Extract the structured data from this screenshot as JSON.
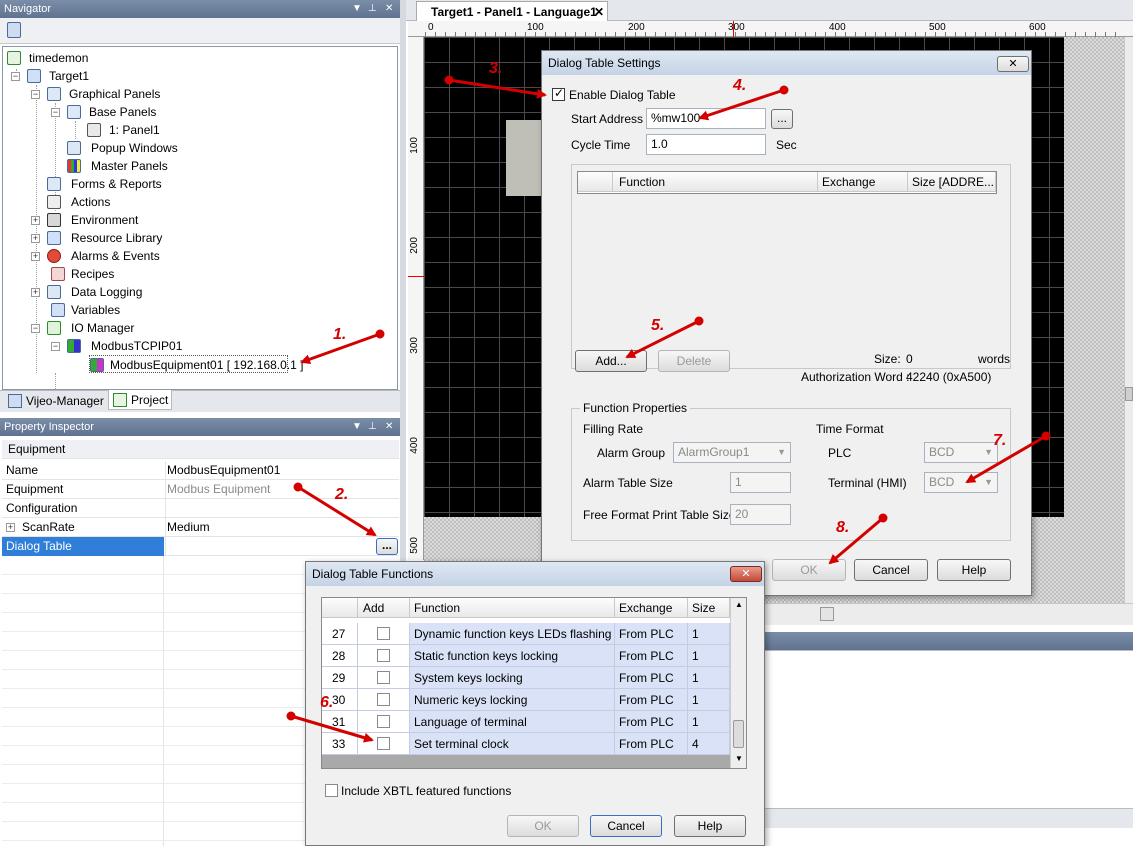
{
  "navigator": {
    "title": "Navigator",
    "tree": [
      {
        "label": "timedemon",
        "icon": "project-icon"
      },
      {
        "label": "Target1",
        "icon": "target-icon"
      },
      {
        "label": "Graphical Panels",
        "icon": "panels-icon"
      },
      {
        "label": "Base Panels",
        "icon": "panels-icon"
      },
      {
        "label": "1: Panel1",
        "icon": "panel-icon"
      },
      {
        "label": "Popup Windows",
        "icon": "window-icon"
      },
      {
        "label": "Master Panels",
        "icon": "master-panel-icon"
      },
      {
        "label": "Forms & Reports",
        "icon": "forms-icon"
      },
      {
        "label": "Actions",
        "icon": "actions-icon"
      },
      {
        "label": "Environment",
        "icon": "environment-icon"
      },
      {
        "label": "Resource Library",
        "icon": "library-icon"
      },
      {
        "label": "Alarms & Events",
        "icon": "alarm-icon"
      },
      {
        "label": "Recipes",
        "icon": "recipe-icon"
      },
      {
        "label": "Data Logging",
        "icon": "data-logging-icon"
      },
      {
        "label": "Variables",
        "icon": "variables-icon"
      },
      {
        "label": "IO Manager",
        "icon": "io-manager-icon"
      },
      {
        "label": "ModbusTCPIP01",
        "icon": "driver-icon"
      },
      {
        "label": "ModbusEquipment01 [ 192.168.0.1 ]",
        "icon": "equipment-icon"
      }
    ],
    "tabs": [
      "Vijeo-Manager",
      "Project"
    ]
  },
  "property_inspector": {
    "title": "Property Inspector",
    "header": "Equipment",
    "rows": [
      {
        "name": "Name",
        "value": "ModbusEquipment01"
      },
      {
        "name": "Equipment",
        "value": "Modbus Equipment"
      },
      {
        "name": "Configuration",
        "value": ""
      },
      {
        "name": "ScanRate",
        "value": "Medium"
      },
      {
        "name": "Dialog Table",
        "value": ""
      }
    ],
    "ellipsis": "..."
  },
  "editor": {
    "tab": "Target1 - Panel1 - Language1",
    "ruler_h": [
      "0",
      "100",
      "200",
      "300",
      "400",
      "500",
      "600"
    ],
    "ruler_v": [
      "100",
      "200",
      "300",
      "400",
      "500"
    ]
  },
  "dialog_settings": {
    "title": "Dialog Table Settings",
    "enable_label": "Enable Dialog Table",
    "start_address_label": "Start Address",
    "start_address_value": "%mw100",
    "browse": "...",
    "cycle_time_label": "Cycle Time",
    "cycle_time_value": "1.0",
    "cycle_unit": "Sec",
    "columns": [
      "Function",
      "Exchange",
      "Size [ADDRE..."
    ],
    "add": "Add...",
    "delete": "Delete",
    "size_label": "Size:",
    "size_value": "0",
    "size_unit": "words",
    "auth_label": "Authorization Word :",
    "auth_value": "42240 (0xA500)",
    "function_props": "Function Properties",
    "filling_rate": "Filling Rate",
    "time_format": "Time Format",
    "alarm_group_label": "Alarm Group",
    "alarm_group_value": "AlarmGroup1",
    "plc_label": "PLC",
    "plc_value": "BCD",
    "alarm_table_size_label": "Alarm Table Size",
    "alarm_table_size_value": "1",
    "terminal_label": "Terminal (HMI)",
    "terminal_value": "BCD",
    "free_format_label": "Free Format Print Table Size",
    "free_format_value": "20",
    "ok": "OK",
    "cancel": "Cancel",
    "help": "Help"
  },
  "dialog_functions": {
    "title": "Dialog Table Functions",
    "columns": [
      "Add",
      "Function",
      "Exchange",
      "Size"
    ],
    "rows": [
      {
        "num": "27",
        "function": "Dynamic function keys LEDs flashing",
        "exchange": "From PLC",
        "size": "1"
      },
      {
        "num": "28",
        "function": "Static function keys locking",
        "exchange": "From PLC",
        "size": "1"
      },
      {
        "num": "29",
        "function": "System keys locking",
        "exchange": "From PLC",
        "size": "1"
      },
      {
        "num": "30",
        "function": "Numeric keys locking",
        "exchange": "From PLC",
        "size": "1"
      },
      {
        "num": "31",
        "function": "Language of terminal",
        "exchange": "From PLC",
        "size": "1"
      },
      {
        "num": "33",
        "function": "Set terminal clock",
        "exchange": "From PLC",
        "size": "4"
      }
    ],
    "include_xbtl": "Include XBTL featured functions",
    "ok": "OK",
    "cancel": "Cancel",
    "help": "Help"
  },
  "steps": [
    "1.",
    "2.",
    "3.",
    "4.",
    "5.",
    "6.",
    "7.",
    "8."
  ],
  "colors": {
    "annotation": "#d40000",
    "pane_title": "#6b7e9b",
    "selection": "#2f7fd8"
  }
}
